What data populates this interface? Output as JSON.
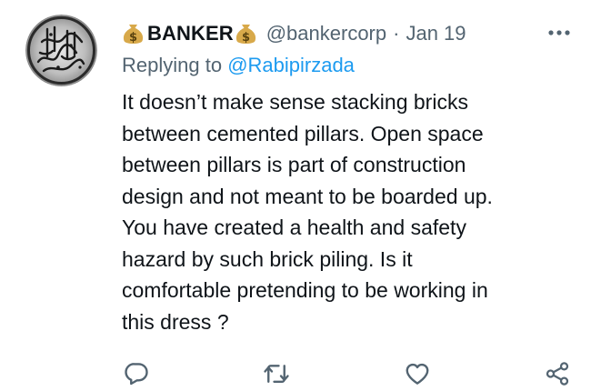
{
  "tweet": {
    "display_name": "BANKER",
    "handle": "@bankercorp",
    "separator": "·",
    "date": "Jan 19",
    "replying_prefix": "Replying to ",
    "replying_to": "@Rabipirzada",
    "text": "It doesn’t make sense stacking bricks\nbetween cemented pillars. Open space\nbetween pillars is part of construction\ndesign and not meant to be boarded up.\nYou have created a health and safety\nhazard by such brick piling. Is it\ncomfortable pretending to be working in\nthis dress ?"
  },
  "icons": {
    "avatar": "calligraphy-avatar",
    "name_prefix": "money-bag-icon",
    "name_suffix": "money-bag-icon",
    "more": "more-icon",
    "reply": "reply-icon",
    "retweet": "retweet-icon",
    "like": "like-icon",
    "share": "share-icon"
  },
  "colors": {
    "primary_text": "#0f1419",
    "secondary_text": "#536471",
    "link": "#1d9bf0",
    "money_bag": "#d8a94a"
  }
}
